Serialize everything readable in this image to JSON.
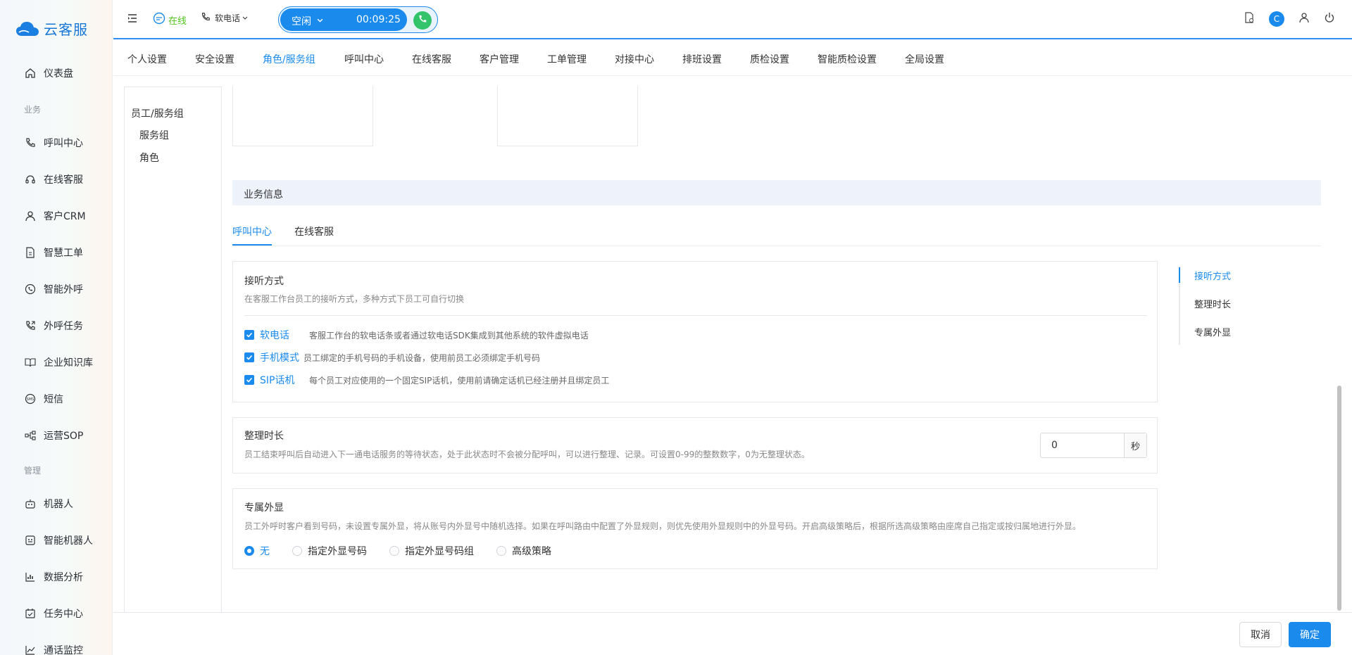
{
  "brand": {
    "name": "云客服"
  },
  "sidebar": {
    "items": [
      {
        "label": "仪表盘",
        "icon": "home-icon"
      },
      {
        "label": "呼叫中心",
        "icon": "phone-icon"
      },
      {
        "label": "在线客服",
        "icon": "headset-icon"
      },
      {
        "label": "客户CRM",
        "icon": "user-icon"
      },
      {
        "label": "智慧工单",
        "icon": "document-icon"
      },
      {
        "label": "智能外呼",
        "icon": "phone-circle-icon"
      },
      {
        "label": "外呼任务",
        "icon": "phone-outgoing-icon"
      },
      {
        "label": "企业知识库",
        "icon": "book-icon"
      },
      {
        "label": "短信",
        "icon": "sms-icon"
      },
      {
        "label": "运营SOP",
        "icon": "flow-icon"
      },
      {
        "label": "机器人",
        "icon": "robot-icon"
      },
      {
        "label": "智能机器人",
        "icon": "smart-robot-icon"
      },
      {
        "label": "数据分析",
        "icon": "bar-chart-icon"
      },
      {
        "label": "任务中心",
        "icon": "task-icon"
      },
      {
        "label": "通话监控",
        "icon": "monitor-icon"
      }
    ],
    "sections": {
      "business": "业务",
      "manage": "管理"
    }
  },
  "header": {
    "status": "在线",
    "phone_mode": "软电话",
    "call_state": "空闲",
    "call_timer": "00:09:25",
    "avatar_letter": "C"
  },
  "tabs": [
    {
      "label": "个人设置"
    },
    {
      "label": "安全设置"
    },
    {
      "label": "角色/服务组"
    },
    {
      "label": "呼叫中心"
    },
    {
      "label": "在线客服"
    },
    {
      "label": "客户管理"
    },
    {
      "label": "工单管理"
    },
    {
      "label": "对接中心"
    },
    {
      "label": "排班设置"
    },
    {
      "label": "质检设置"
    },
    {
      "label": "智能质检设置"
    },
    {
      "label": "全局设置"
    }
  ],
  "active_tab": "角色/服务组",
  "subnav": {
    "group": "员工/服务组",
    "items": [
      "服务组",
      "角色"
    ]
  },
  "business": {
    "title": "业务信息",
    "subtabs": [
      "呼叫中心",
      "在线客服"
    ],
    "active_subtab": "呼叫中心"
  },
  "answer_mode": {
    "title": "接听方式",
    "desc": "在客服工作台员工的接听方式，多种方式下员工可自行切换",
    "options": [
      {
        "name": "软电话",
        "desc": "客服工作台的软电话条或者通过软电话SDK集成到其他系统的软件虚拟电话",
        "checked": true
      },
      {
        "name": "手机模式",
        "desc": "员工绑定的手机号码的手机设备，使用前员工必须绑定手机号码",
        "checked": true
      },
      {
        "name": "SIP话机",
        "desc": "每个员工对应使用的一个固定SIP话机，使用前请确定话机已经注册并且绑定员工",
        "checked": true
      }
    ]
  },
  "wrap_time": {
    "title": "整理时长",
    "desc": "员工结束呼叫后自动进入下一通电话服务的等待状态，处于此状态时不会被分配呼叫，可以进行整理、记录。可设置0-99的整数数字，0为无整理状态。",
    "value": "0",
    "unit": "秒"
  },
  "caller_id": {
    "title": "专属外显",
    "desc": "员工外呼时客户看到号码，未设置专属外显，将从账号内外显号中随机选择。如果在呼叫路由中配置了外显规则，则优先使用外显规则中的外显号码。开启高级策略后，根据所选高级策略由座席自己指定或按归属地进行外显。",
    "options": [
      "无",
      "指定外显号码",
      "指定外显号码组",
      "高级策略"
    ],
    "selected": "无"
  },
  "anchors": [
    "接听方式",
    "整理时长",
    "专属外显"
  ],
  "active_anchor": "接听方式",
  "footer": {
    "cancel": "取消",
    "ok": "确定"
  },
  "colors": {
    "primary": "#1a8aec",
    "online": "#52c41a",
    "call_green": "#33c46b"
  }
}
